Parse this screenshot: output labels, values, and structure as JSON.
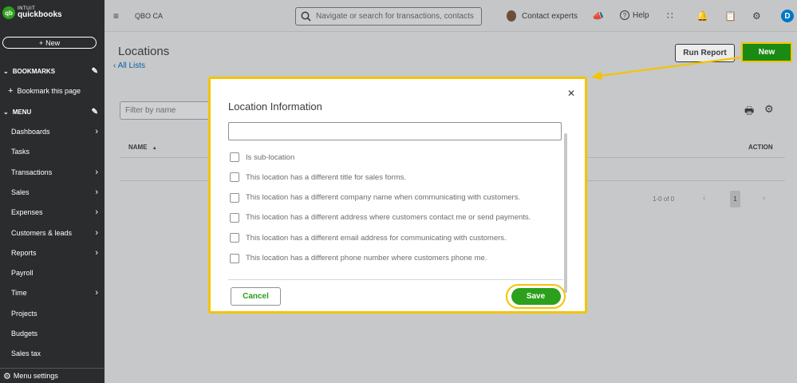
{
  "sidebar": {
    "logo_intuit": "INTUIT",
    "logo_name": "quickbooks",
    "logo_mark": "qb",
    "new_label": "New",
    "bookmarks_label": "BOOKMARKS",
    "bookmark_page_label": "Bookmark this page",
    "menu_label": "MENU",
    "items": [
      {
        "label": "Dashboards",
        "has_arrow": true
      },
      {
        "label": "Tasks",
        "has_arrow": false
      },
      {
        "label": "Transactions",
        "has_arrow": true
      },
      {
        "label": "Sales",
        "has_arrow": true
      },
      {
        "label": "Expenses",
        "has_arrow": true
      },
      {
        "label": "Customers & leads",
        "has_arrow": true
      },
      {
        "label": "Reports",
        "has_arrow": true
      },
      {
        "label": "Payroll",
        "has_arrow": false
      },
      {
        "label": "Time",
        "has_arrow": true
      },
      {
        "label": "Projects",
        "has_arrow": false
      },
      {
        "label": "Budgets",
        "has_arrow": false
      },
      {
        "label": "Sales tax",
        "has_arrow": false
      }
    ],
    "menu_settings_label": "Menu settings"
  },
  "topbar": {
    "company": "QBO CA",
    "search_placeholder": "Navigate or search for transactions, contacts",
    "contact_experts": "Contact experts",
    "help": "Help",
    "avatar_initial": "D"
  },
  "page": {
    "title": "Locations",
    "back_link": "All Lists",
    "run_report": "Run Report",
    "new_button": "New",
    "filter_placeholder": "Filter by name",
    "col_name": "NAME",
    "col_action": "ACTION",
    "pagination_text": "1-0 of 0",
    "current_page": "1"
  },
  "modal": {
    "title": "Location Information",
    "name_value": "",
    "checkboxes": [
      {
        "label": "Is sub-location",
        "checked": false
      },
      {
        "label": "This location has a different title for sales forms.",
        "checked": false
      },
      {
        "label": "This location has a different company name when communicating with customers.",
        "checked": false
      },
      {
        "label": "This location has a different address where customers contact me or send payments.",
        "checked": false
      },
      {
        "label": "This location has a different email address for communicating with customers.",
        "checked": false
      },
      {
        "label": "This location has a different phone number where customers phone me.",
        "checked": false
      }
    ],
    "cancel": "Cancel",
    "save": "Save"
  },
  "colors": {
    "brand_green": "#2ca01c",
    "highlight_yellow": "#f4c400",
    "link_blue": "#0b5ea8"
  }
}
